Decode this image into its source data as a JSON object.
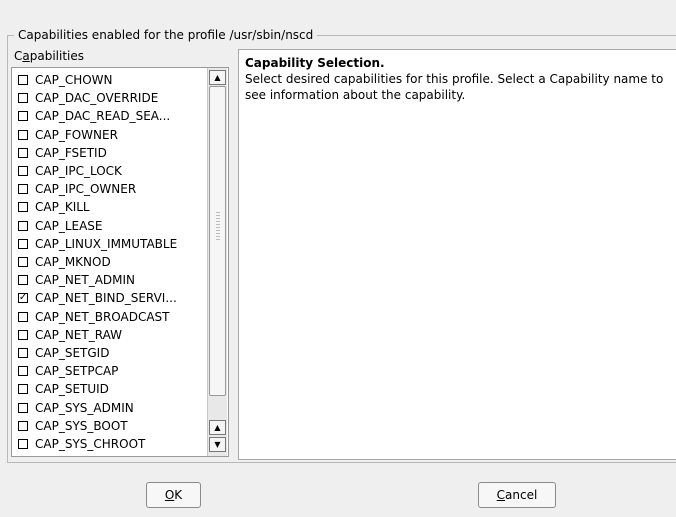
{
  "group_title": "Capabilities enabled for the profile /usr/sbin/nscd",
  "capabilities_label": {
    "mnemonic": "a",
    "before": "C",
    "after": "pabilities"
  },
  "capabilities": [
    {
      "label": "CAP_CHOWN",
      "checked": false
    },
    {
      "label": "CAP_DAC_OVERRIDE",
      "checked": false
    },
    {
      "label": "CAP_DAC_READ_SEA...",
      "checked": false
    },
    {
      "label": "CAP_FOWNER",
      "checked": false
    },
    {
      "label": "CAP_FSETID",
      "checked": false
    },
    {
      "label": "CAP_IPC_LOCK",
      "checked": false
    },
    {
      "label": "CAP_IPC_OWNER",
      "checked": false
    },
    {
      "label": "CAP_KILL",
      "checked": false
    },
    {
      "label": "CAP_LEASE",
      "checked": false
    },
    {
      "label": "CAP_LINUX_IMMUTABLE",
      "checked": false
    },
    {
      "label": "CAP_MKNOD",
      "checked": false
    },
    {
      "label": "CAP_NET_ADMIN",
      "checked": false
    },
    {
      "label": "CAP_NET_BIND_SERVI...",
      "checked": true
    },
    {
      "label": "CAP_NET_BROADCAST",
      "checked": false
    },
    {
      "label": "CAP_NET_RAW",
      "checked": false
    },
    {
      "label": "CAP_SETGID",
      "checked": false
    },
    {
      "label": "CAP_SETPCAP",
      "checked": false
    },
    {
      "label": "CAP_SETUID",
      "checked": false
    },
    {
      "label": "CAP_SYS_ADMIN",
      "checked": false
    },
    {
      "label": "CAP_SYS_BOOT",
      "checked": false
    },
    {
      "label": "CAP_SYS_CHROOT",
      "checked": false
    }
  ],
  "info": {
    "title": "Capability Selection",
    "text": "Select desired capabilities for this profile. Select a Capability name to see information about the capability."
  },
  "buttons": {
    "ok": {
      "mnemonic": "O",
      "rest": "K"
    },
    "cancel": {
      "mnemonic": "C",
      "rest": "ancel"
    }
  },
  "icons": {
    "scroll_up": "triangle-up",
    "scroll_down": "triangle-down",
    "check": "checkmark"
  }
}
